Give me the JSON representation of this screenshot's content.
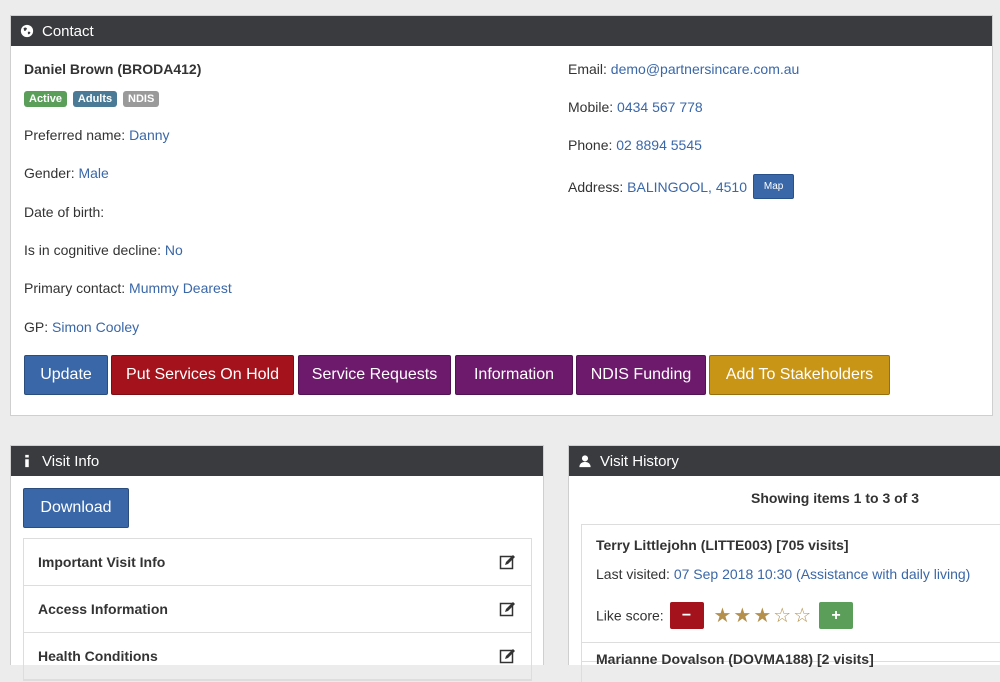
{
  "contact": {
    "header": "Contact",
    "name": "Daniel Brown (BRODA412)",
    "badges": [
      {
        "label": "Active",
        "color": "#5a9e5a"
      },
      {
        "label": "Adults",
        "color": "#4a7a96"
      },
      {
        "label": "NDIS",
        "color": "#9a9a9a"
      }
    ],
    "fields": {
      "preferred_label": "Preferred name:",
      "preferred_value": "Danny",
      "gender_label": "Gender:",
      "gender_value": "Male",
      "dob_label": "Date of birth:",
      "cognitive_label": "Is in cognitive decline:",
      "cognitive_value": "No",
      "primary_label": "Primary contact:",
      "primary_value": "Mummy Dearest",
      "gp_label": "GP:",
      "gp_value": "Simon Cooley",
      "email_label": "Email:",
      "email_value": "demo@partnersincare.com.au",
      "mobile_label": "Mobile:",
      "mobile_value": "0434 567 778",
      "phone_label": "Phone:",
      "phone_value": "02 8894 5545",
      "address_label": "Address:",
      "address_value": "BALINGOOL, 4510",
      "map_label": "Map"
    },
    "buttons": {
      "update": "Update",
      "hold": "Put Services On Hold",
      "requests": "Service Requests",
      "information": "Information",
      "ndis": "NDIS Funding",
      "stakeholders": "Add To Stakeholders"
    },
    "colors": {
      "blue": "#3a67a8",
      "red": "#a4121c",
      "purple": "#6d1a6d",
      "gold": "#c99516"
    }
  },
  "visit_info": {
    "header": "Visit Info",
    "download": "Download",
    "items": [
      "Important Visit Info",
      "Access Information",
      "Health Conditions"
    ]
  },
  "visit_history": {
    "header": "Visit History",
    "summary": "Showing items 1 to 3 of 3",
    "entries": [
      {
        "name": "Terry Littlejohn (LITTE003) [705 visits]",
        "last_label": "Last visited:",
        "last_value": "07 Sep 2018 10:30 (Assistance with daily living)",
        "like_label": "Like score:",
        "rating": 3,
        "max_rating": 5
      },
      {
        "name": "Marianne Dovalson (DOVMA188) [2 visits]"
      }
    ]
  }
}
